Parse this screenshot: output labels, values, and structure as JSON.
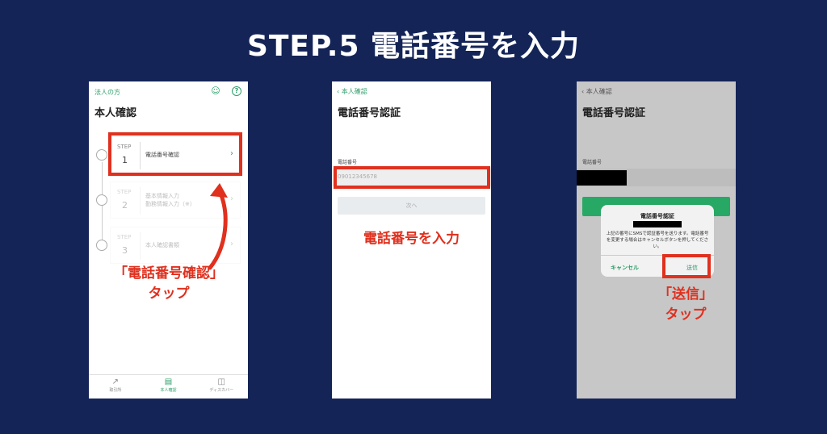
{
  "title": "STEP.5 電話番号を入力",
  "phone1": {
    "header_link": "法人の方",
    "page_title": "本人確認",
    "steps": [
      {
        "step_label": "STEP",
        "step_num": "1",
        "label": "電話番号確認"
      },
      {
        "step_label": "STEP",
        "step_num": "2",
        "label": "基本情報入力\n勤務情報入力（※）"
      },
      {
        "step_label": "STEP",
        "step_num": "3",
        "label": "本人確認書類"
      }
    ],
    "annotation": "「電話番号確認」\nタップ",
    "tabs": [
      {
        "label": "取引所"
      },
      {
        "label": "本人確認"
      },
      {
        "label": "ディスカバー"
      }
    ]
  },
  "phone2": {
    "back": "本人確認",
    "page_title": "電話番号認証",
    "field_label": "電話番号",
    "field_value": "09012345678",
    "next_button": "次へ",
    "annotation": "電話番号を入力"
  },
  "phone3": {
    "back": "本人確認",
    "page_title": "電話番号認証",
    "field_label": "電話番号",
    "dialog": {
      "title": "電話番号認証",
      "message": "上記の番号にSMSで認証番号を送ります。電話番号を変更する場合はキャンセルボタンを押してください。",
      "cancel": "キャンセル",
      "send": "送信"
    },
    "annotation": "「送信」\nタップ"
  },
  "colors": {
    "background": "#142457",
    "accent_green": "#2e9e6a",
    "highlight_red": "#e0301e"
  }
}
